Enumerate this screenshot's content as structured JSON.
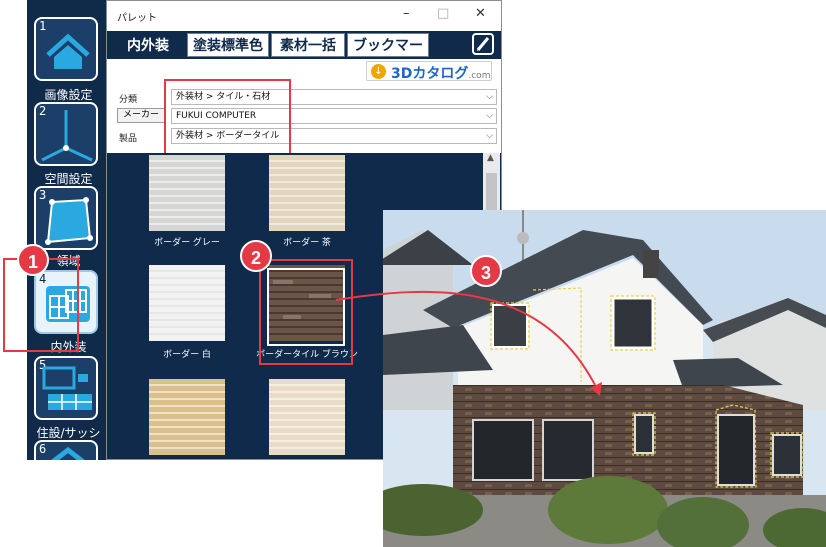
{
  "toolbar": {
    "items": [
      {
        "number": "1",
        "label": "画像設定",
        "icon": "house-roof-icon"
      },
      {
        "number": "2",
        "label": "空間設定",
        "icon": "space-axes-icon"
      },
      {
        "number": "3",
        "label": "領域",
        "icon": "region-polygon-icon"
      },
      {
        "number": "4",
        "label": "内外装",
        "icon": "interior-exterior-tile-icon"
      },
      {
        "number": "5",
        "label": "住設/サッシ",
        "icon": "equipment-sash-icon"
      },
      {
        "number": "6",
        "label": "",
        "icon": "house-roof-icon"
      }
    ]
  },
  "palette": {
    "title": "パレット",
    "window_buttons": {
      "minimize": "–",
      "maximize": "□",
      "close": "✕"
    },
    "tabs": [
      {
        "label": "内外装",
        "active": true
      },
      {
        "label": "塗装標準色",
        "active": false
      },
      {
        "label": "素材一括",
        "active": false
      },
      {
        "label": "ブックマーク",
        "active": false
      }
    ],
    "catalog": {
      "brand": "3Dカタログ",
      "suffix": ".com"
    },
    "filters": {
      "category_label": "分類",
      "category_value": "外装材 > タイル・石材",
      "maker_button": "メーカー",
      "maker_value": "FUKUI COMPUTER",
      "product_label": "製品",
      "product_value": "外装材 > ボーダータイル"
    },
    "swatches": [
      {
        "label": "ボーダー グレー",
        "color": "#d6d6d4"
      },
      {
        "label": "ボーダー 茶",
        "color": "#e3d6bf"
      },
      {
        "label": "ボーダー 白",
        "color": "#f2f2f2"
      },
      {
        "label": "ボーダータイル ブラウン",
        "color": "#6a5548"
      },
      {
        "label": "",
        "color": "#dcc08b"
      },
      {
        "label": "",
        "color": "#e9dcc6"
      }
    ]
  },
  "badges": {
    "b1": "1",
    "b2": "2",
    "b3": "3"
  },
  "colors": {
    "accent_red": "#e53945",
    "panel_navy": "#0f2a4b"
  }
}
